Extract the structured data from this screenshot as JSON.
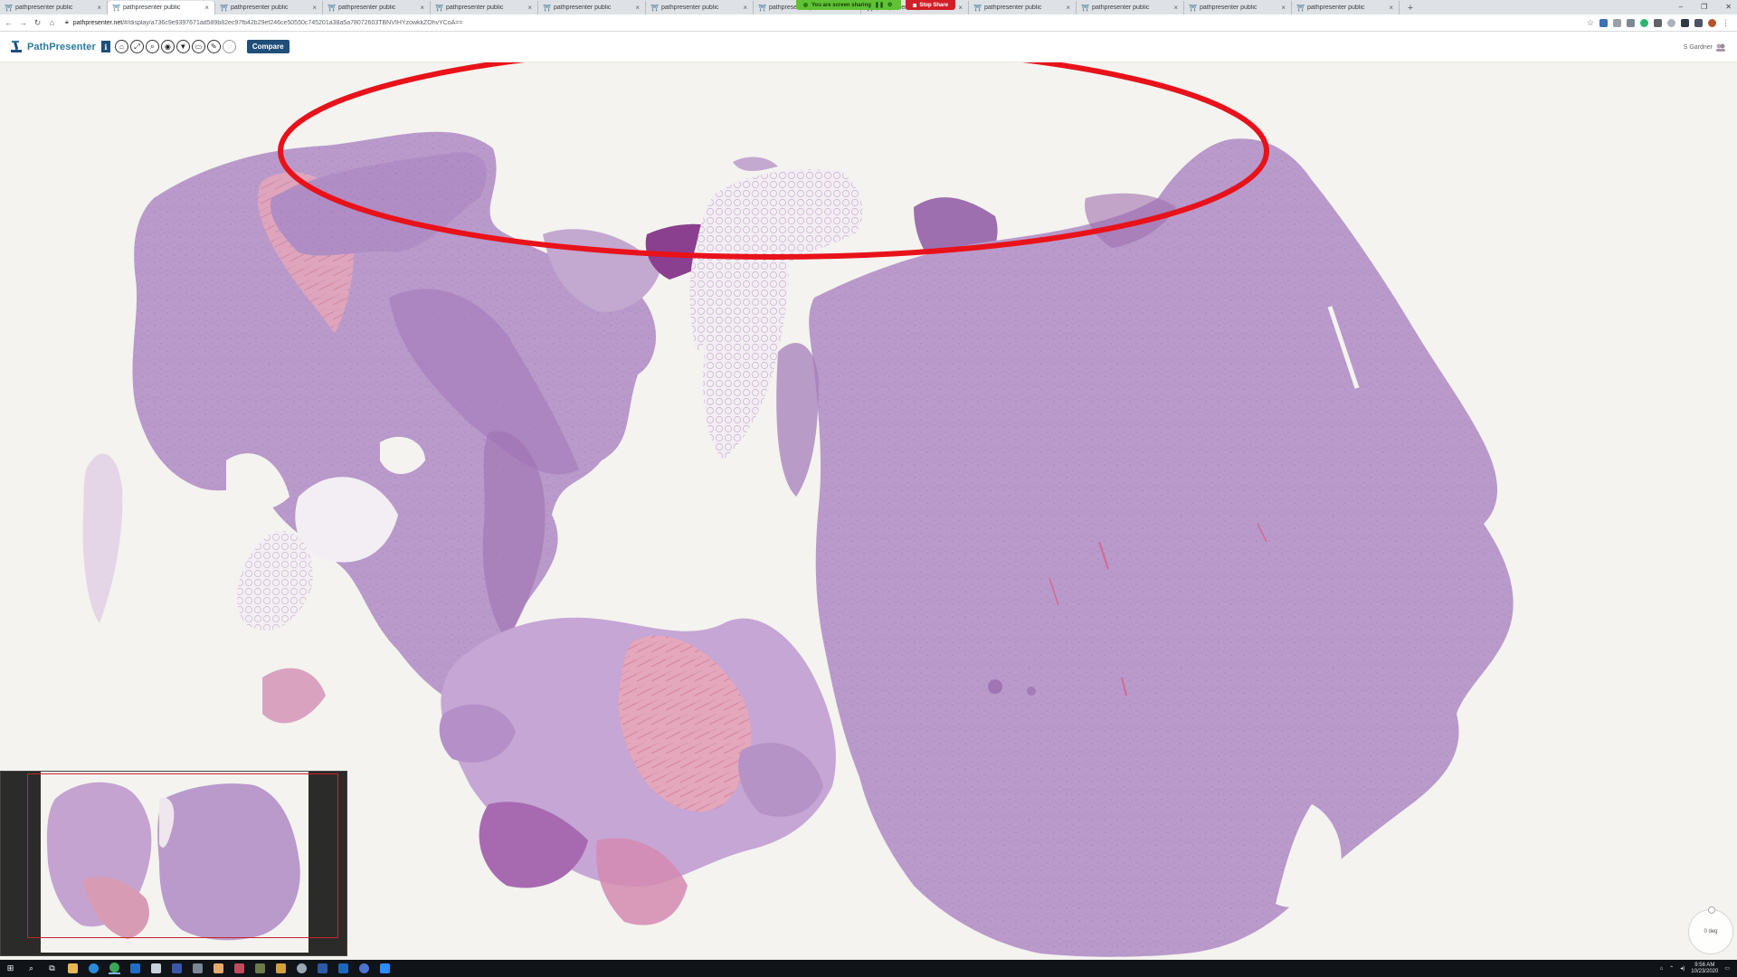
{
  "browser": {
    "tabs": [
      {
        "label": "pathpresenter public",
        "active": false
      },
      {
        "label": "pathpresenter public",
        "active": true
      },
      {
        "label": "pathpresenter public",
        "active": false
      },
      {
        "label": "pathpresenter public",
        "active": false
      },
      {
        "label": "pathpresenter public",
        "active": false
      },
      {
        "label": "pathpresenter public",
        "active": false
      },
      {
        "label": "pathpresenter public",
        "active": false
      },
      {
        "label": "pathpresenter public",
        "active": false
      },
      {
        "label": "pathpresenter public",
        "active": false
      },
      {
        "label": "pathpresenter public",
        "active": false
      },
      {
        "label": "pathpresenter public",
        "active": false
      },
      {
        "label": "pathpresenter public",
        "active": false
      },
      {
        "label": "pathpresenter public",
        "active": false
      }
    ],
    "new_tab": "+",
    "screen_share": {
      "status_text": "You are screen sharing",
      "stop_label": "Stop Share"
    },
    "url_host": "pathpresenter.net",
    "url_path": "/#/display/a736c9e9397671ad589b82ec97fb42b29ef246ce50550c745201a38a5a78072603TBNVIHYzowkkZOhvYCoA==",
    "window_controls": [
      "–",
      "❐",
      "✕"
    ]
  },
  "app": {
    "brand_name": "PathPresenter",
    "info_label": "i",
    "tools": [
      "⌂",
      "⤢",
      "⌕",
      "◉",
      "▼",
      "▭",
      "✎",
      "◌"
    ],
    "compare_label": "Compare",
    "user_name": "S Gardner"
  },
  "viewer": {
    "rotation_label": "0 deg",
    "annotation_color": "#e8121a",
    "overview_box_color": "#c8232c"
  },
  "taskbar": {
    "time": "9:56 AM",
    "date": "10/23/2020"
  },
  "colors": {
    "accent": "#1f4e79",
    "brand": "#2b7aa0",
    "tissue_main": "#b697c7",
    "tissue_dark": "#9e6fae",
    "tissue_pink": "#d88aa5",
    "background": "#f4f3ef"
  }
}
